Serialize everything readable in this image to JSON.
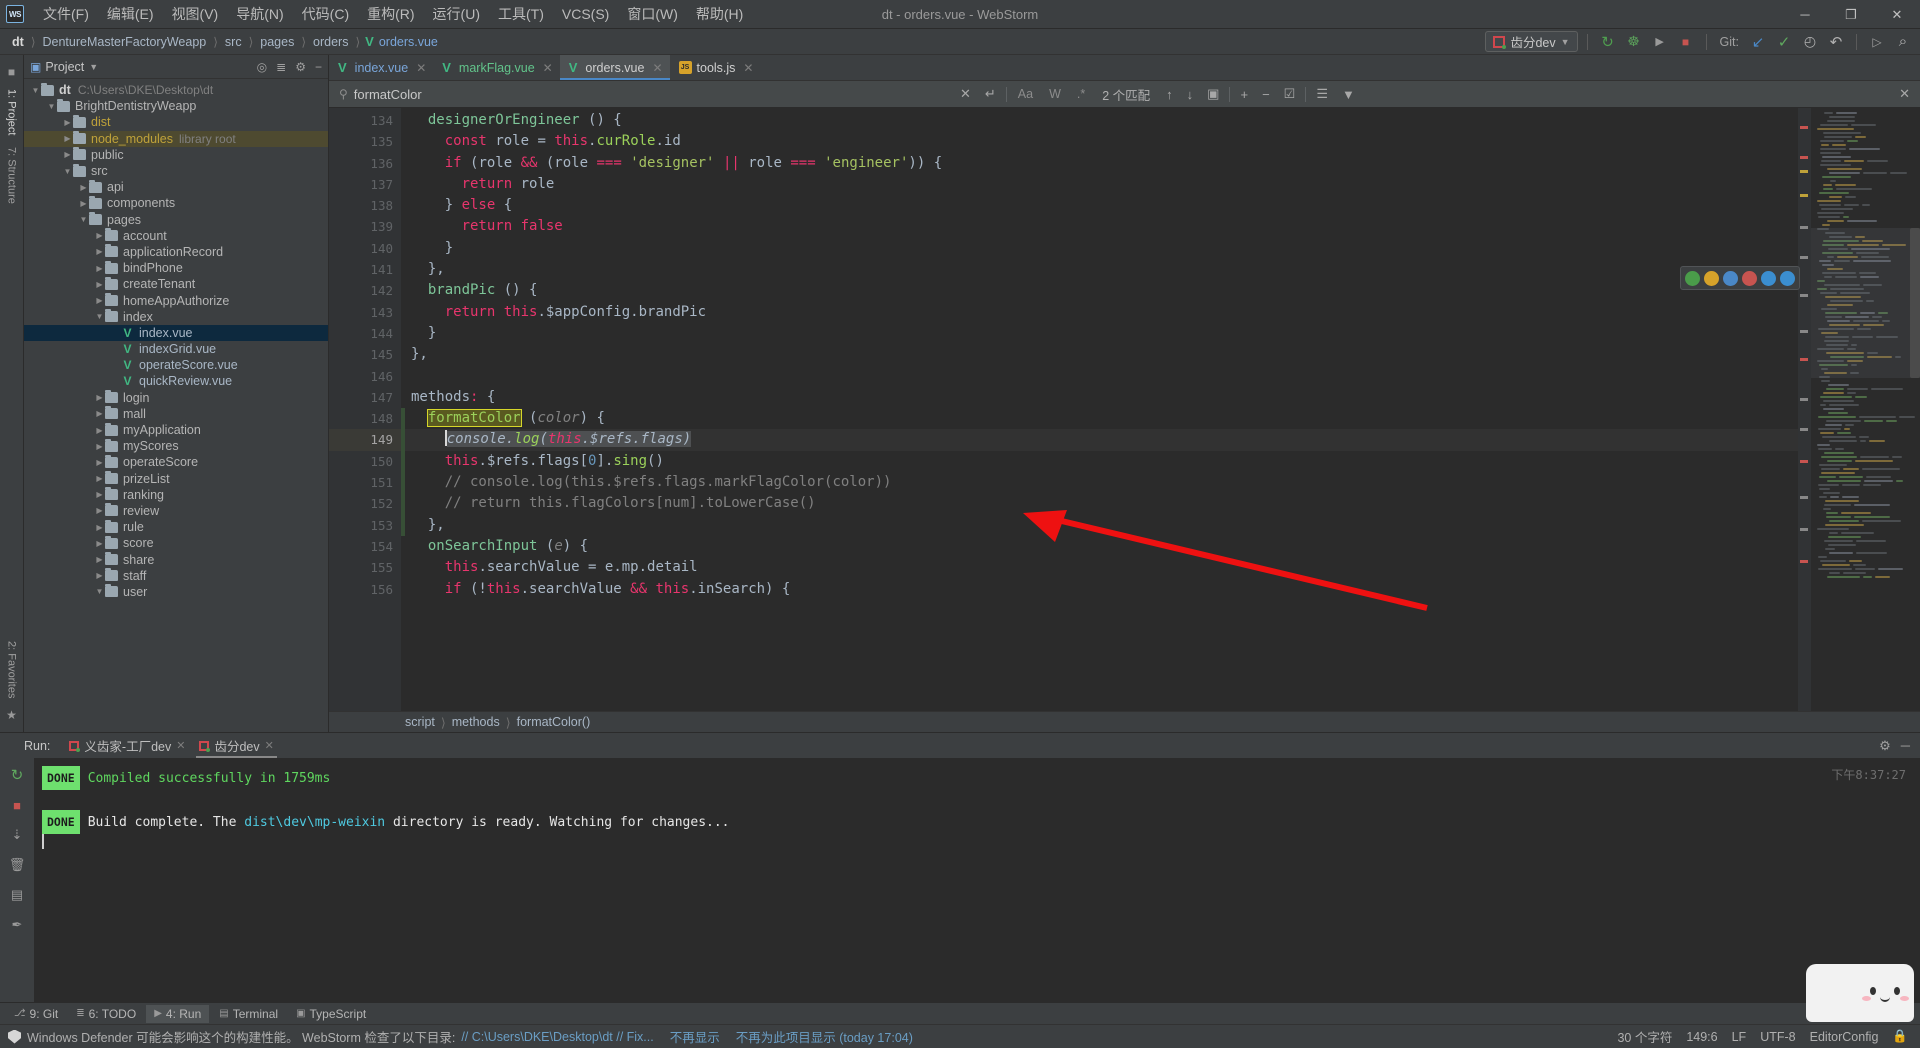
{
  "window": {
    "title": "dt - orders.vue - WebStorm",
    "logo": "WS",
    "controls": {
      "minimize": "─",
      "maximize": "❐",
      "close": "✕"
    }
  },
  "menu": {
    "items": [
      {
        "label": "文件(F)"
      },
      {
        "label": "编辑(E)"
      },
      {
        "label": "视图(V)"
      },
      {
        "label": "导航(N)"
      },
      {
        "label": "代码(C)"
      },
      {
        "label": "重构(R)"
      },
      {
        "label": "运行(U)"
      },
      {
        "label": "工具(T)"
      },
      {
        "label": "VCS(S)"
      },
      {
        "label": "窗口(W)"
      },
      {
        "label": "帮助(H)"
      }
    ]
  },
  "breadcrumb": {
    "items": [
      "dt",
      "DentureMasterFactoryWeapp",
      "src",
      "pages",
      "orders"
    ],
    "file": "orders.vue",
    "file_icon": "vue-icon"
  },
  "toolbar": {
    "run_config": "齿分dev",
    "run_config_icon": "run-config-icon",
    "buttons": [
      {
        "name": "rerun-icon",
        "glyph": "↻",
        "color": "#4f9e4f"
      },
      {
        "name": "debug-icon",
        "glyph": "☸",
        "color": "#5a9e5a"
      },
      {
        "name": "run-with-coverage-icon",
        "glyph": "▶",
        "color": "#9a9a9a"
      },
      {
        "name": "stop-icon",
        "glyph": "■",
        "color": "#c75450"
      }
    ],
    "git_label": "Git:",
    "git_buttons": [
      {
        "name": "update-project-icon",
        "glyph": "↙",
        "color": "#4a88c7"
      },
      {
        "name": "commit-icon",
        "glyph": "✓",
        "color": "#5fa85f"
      },
      {
        "name": "history-icon",
        "glyph": "◴",
        "color": "#b0b0b0"
      },
      {
        "name": "rollback-icon",
        "glyph": "↶",
        "color": "#b0b0b0"
      }
    ],
    "right_buttons": [
      {
        "name": "search-everywhere-icon",
        "glyph": "⌕"
      }
    ]
  },
  "left_strip": {
    "top_label": "1: Project",
    "structure_label": "7: Structure",
    "favorites_label": "2: Favorites"
  },
  "project": {
    "title": "Project",
    "header_icons": [
      "target-icon",
      "collapse-all-icon",
      "settings-icon",
      "hide-icon"
    ],
    "tree": [
      {
        "depth": 0,
        "arrow": "▼",
        "icon": "folder",
        "name": "dt",
        "bold": true,
        "suffix": "C:\\Users\\DKE\\Desktop\\dt"
      },
      {
        "depth": 1,
        "arrow": "▼",
        "icon": "folder",
        "name": "BrightDentistryWeapp"
      },
      {
        "depth": 2,
        "arrow": "▶",
        "icon": "folder",
        "name": "dist",
        "color": "yellow"
      },
      {
        "depth": 2,
        "arrow": "▶",
        "icon": "folder",
        "name": "node_modules",
        "color": "yellow",
        "suffix": "library root",
        "highlight": true
      },
      {
        "depth": 2,
        "arrow": "▶",
        "icon": "folder",
        "name": "public"
      },
      {
        "depth": 2,
        "arrow": "▼",
        "icon": "folder",
        "name": "src"
      },
      {
        "depth": 3,
        "arrow": "▶",
        "icon": "folder",
        "name": "api"
      },
      {
        "depth": 3,
        "arrow": "▶",
        "icon": "folder",
        "name": "components"
      },
      {
        "depth": 3,
        "arrow": "▼",
        "icon": "folder",
        "name": "pages"
      },
      {
        "depth": 4,
        "arrow": "▶",
        "icon": "folder",
        "name": "account"
      },
      {
        "depth": 4,
        "arrow": "▶",
        "icon": "folder",
        "name": "applicationRecord"
      },
      {
        "depth": 4,
        "arrow": "▶",
        "icon": "folder",
        "name": "bindPhone"
      },
      {
        "depth": 4,
        "arrow": "▶",
        "icon": "folder",
        "name": "createTenant"
      },
      {
        "depth": 4,
        "arrow": "▶",
        "icon": "folder",
        "name": "homeAppAuthorize"
      },
      {
        "depth": 4,
        "arrow": "▼",
        "icon": "folder",
        "name": "index"
      },
      {
        "depth": 5,
        "arrow": "",
        "icon": "vue",
        "name": "index.vue",
        "selected": true
      },
      {
        "depth": 5,
        "arrow": "",
        "icon": "vue",
        "name": "indexGrid.vue"
      },
      {
        "depth": 5,
        "arrow": "",
        "icon": "vue",
        "name": "operateScore.vue"
      },
      {
        "depth": 5,
        "arrow": "",
        "icon": "vue",
        "name": "quickReview.vue"
      },
      {
        "depth": 4,
        "arrow": "▶",
        "icon": "folder",
        "name": "login"
      },
      {
        "depth": 4,
        "arrow": "▶",
        "icon": "folder",
        "name": "mall"
      },
      {
        "depth": 4,
        "arrow": "▶",
        "icon": "folder",
        "name": "myApplication"
      },
      {
        "depth": 4,
        "arrow": "▶",
        "icon": "folder",
        "name": "myScores"
      },
      {
        "depth": 4,
        "arrow": "▶",
        "icon": "folder",
        "name": "operateScore"
      },
      {
        "depth": 4,
        "arrow": "▶",
        "icon": "folder",
        "name": "prizeList"
      },
      {
        "depth": 4,
        "arrow": "▶",
        "icon": "folder",
        "name": "ranking"
      },
      {
        "depth": 4,
        "arrow": "▶",
        "icon": "folder",
        "name": "review"
      },
      {
        "depth": 4,
        "arrow": "▶",
        "icon": "folder",
        "name": "rule"
      },
      {
        "depth": 4,
        "arrow": "▶",
        "icon": "folder",
        "name": "score"
      },
      {
        "depth": 4,
        "arrow": "▶",
        "icon": "folder",
        "name": "share"
      },
      {
        "depth": 4,
        "arrow": "▶",
        "icon": "folder",
        "name": "staff"
      },
      {
        "depth": 4,
        "arrow": "▼",
        "icon": "folder",
        "name": "user"
      }
    ]
  },
  "editor_tabs": [
    {
      "label": "index.vue",
      "icon": "vue-icon",
      "color": "blue",
      "active": false
    },
    {
      "label": "markFlag.vue",
      "icon": "vue-icon",
      "color": "green",
      "active": false
    },
    {
      "label": "orders.vue",
      "icon": "vue-icon",
      "color": "white",
      "active": true
    },
    {
      "label": "tools.js",
      "icon": "js-icon",
      "color": "white",
      "active": false
    }
  ],
  "search": {
    "value": "formatColor",
    "placeholder": "Search",
    "toggles": [
      {
        "name": "match-case-toggle",
        "label": "Aa"
      },
      {
        "name": "whole-words-toggle",
        "label": "W"
      },
      {
        "name": "regex-toggle",
        "label": ".*"
      }
    ],
    "match_count": "2 个匹配",
    "nav": [
      {
        "name": "prev-match-button",
        "glyph": "↑"
      },
      {
        "name": "next-match-button",
        "glyph": "↓"
      },
      {
        "name": "select-all-occurrences-button",
        "glyph": "▣"
      }
    ],
    "right_icons": [
      {
        "name": "add-selection-icon",
        "glyph": "+"
      },
      {
        "name": "remove-selection-icon",
        "glyph": "−"
      },
      {
        "name": "select-all-icon",
        "glyph": "☑"
      },
      {
        "name": "open-in-find-window-icon",
        "glyph": "☰"
      },
      {
        "name": "filter-icon",
        "glyph": "▼"
      }
    ],
    "close_glyph": "✕",
    "replace_glyph": "↵"
  },
  "code": {
    "first_line": 134,
    "current_line": 149,
    "lines": [
      {
        "n": 134,
        "fold": "-",
        "change": false,
        "html": "  <span class='f'>designerOrEngineer</span> <span class='p'>() {</span>"
      },
      {
        "n": 135,
        "fold": "",
        "change": false,
        "html": "    <span class='kw'>const</span> <span class='p'>role = </span><span class='this'>this</span><span class='p'>.</span><span class='fn'>curRole</span><span class='p'>.id</span>"
      },
      {
        "n": 136,
        "fold": "-",
        "change": false,
        "html": "    <span class='kw'>if</span> <span class='p'>(role </span><span class='kw'>&amp;&amp;</span><span class='p'> (role </span><span class='kw'>===</span><span class='p'> </span><span class='s'>'designer'</span><span class='p'> </span><span class='kw'>||</span><span class='p'> role </span><span class='kw'>===</span><span class='p'> </span><span class='s'>'engineer'</span><span class='p'>)) {</span>"
      },
      {
        "n": 137,
        "fold": "",
        "change": false,
        "html": "      <span class='kw'>return</span><span class='p'> role</span>"
      },
      {
        "n": 138,
        "fold": "-",
        "change": false,
        "html": "    <span class='p'>} </span><span class='kw'>else</span><span class='p'> {</span>"
      },
      {
        "n": 139,
        "fold": "",
        "change": false,
        "html": "      <span class='kw'>return</span><span class='p'> </span><span class='kw'>false</span>"
      },
      {
        "n": 140,
        "fold": "-",
        "change": false,
        "html": "    <span class='p'>}</span>"
      },
      {
        "n": 141,
        "fold": "",
        "change": false,
        "html": "  <span class='p'>},</span>"
      },
      {
        "n": 142,
        "fold": "-",
        "change": false,
        "html": "  <span class='f'>brandPic</span> <span class='p'>() {</span>"
      },
      {
        "n": 143,
        "fold": "",
        "change": false,
        "html": "    <span class='kw'>return</span><span class='p'> </span><span class='this'>this</span><span class='p'>.$appConfig.brandPic</span>"
      },
      {
        "n": 144,
        "fold": "-",
        "change": false,
        "html": "  <span class='p'>}</span>"
      },
      {
        "n": 145,
        "fold": "-",
        "change": false,
        "html": "<span class='p'>},</span>"
      },
      {
        "n": 146,
        "fold": "",
        "change": false,
        "html": ""
      },
      {
        "n": 147,
        "fold": "-",
        "change": false,
        "html": "<span class='p'>methods</span><span class='kw'>:</span><span class='p'> {</span>"
      },
      {
        "n": 148,
        "fold": "-",
        "change": true,
        "html": "  <span class='match-hl'>formatColor</span> <span class='p'>(</span><span class='c italic'>color</span><span class='p'>) {</span>"
      },
      {
        "n": 149,
        "fold": "",
        "change": true,
        "current": true,
        "html": "    <span class='caret'></span><span class='sel-hl italic'><span class='id'>console</span><span class='p'>.</span><span class='fn'>log</span><span class='p'>(</span><span class='this'>this</span><span class='p'>.$refs.flags)</span></span>"
      },
      {
        "n": 150,
        "fold": "",
        "change": true,
        "html": "    <span class='this'>this</span><span class='p'>.$refs.flags[</span><span class='n'>0</span><span class='p'>].</span><span class='fn'>sing</span><span class='p'>()</span>"
      },
      {
        "n": 151,
        "fold": "-",
        "change": true,
        "html": "    <span class='c'>// console.log(this.$refs.flags.markFlagColor(color))</span>"
      },
      {
        "n": 152,
        "fold": "-",
        "change": true,
        "html": "    <span class='c'>// return this.flagColors[num].toLowerCase()</span>"
      },
      {
        "n": 153,
        "fold": "-",
        "change": true,
        "html": "  <span class='p'>},</span>"
      },
      {
        "n": 154,
        "fold": "-",
        "change": false,
        "html": "  <span class='f'>onSearchInput</span> <span class='p'>(</span><span class='c italic'>e</span><span class='p'>) {</span>"
      },
      {
        "n": 155,
        "fold": "",
        "change": false,
        "html": "    <span class='this'>this</span><span class='p'>.searchValue = </span><span class='id'>e</span><span class='p'>.mp.detail</span>"
      },
      {
        "n": 156,
        "fold": "-",
        "change": false,
        "html": "    <span class='kw'>if</span><span class='p'> (!</span><span class='this'>this</span><span class='p'>.searchValue </span><span class='kw'>&amp;&amp;</span><span class='p'> </span><span class='this'>this</span><span class='p'>.inSearch) {</span>"
      }
    ]
  },
  "editor_breadcrumbs": [
    "script",
    "methods",
    "formatColor()"
  ],
  "inspection_widget": {
    "dots": [
      {
        "name": "inspection-ok-icon",
        "color": "#4a9c4a"
      },
      {
        "name": "inspection-warn-icon",
        "color": "#d6a22a"
      },
      {
        "name": "inspection-info-icon",
        "color": "#4a88c7"
      },
      {
        "name": "inspection-error-icon",
        "color": "#c75450"
      },
      {
        "name": "inspection-typo-icon",
        "color": "#3b8ed0"
      },
      {
        "name": "inspection-settings-icon",
        "color": "#3b8ed0"
      }
    ]
  },
  "run_panel": {
    "label": "Run:",
    "tabs": [
      {
        "label": "义齿家-工厂dev",
        "active": false
      },
      {
        "label": "齿分dev",
        "active": true
      }
    ],
    "header_icons": [
      {
        "name": "settings-icon",
        "glyph": "⚙"
      },
      {
        "name": "hide-icon",
        "glyph": "─"
      }
    ],
    "side_icons": [
      {
        "name": "rerun-icon",
        "glyph": "↻",
        "color": "#5fa85f"
      },
      {
        "name": "stop-icon",
        "glyph": "■",
        "color": "#c75450"
      },
      {
        "name": "scroll-to-end-icon",
        "glyph": "↓",
        "color": "#9a9a9a"
      },
      {
        "name": "trash-icon",
        "glyph": "Ὕ1",
        "color": "#9a9a9a"
      },
      {
        "name": "print-icon",
        "glyph": "☷",
        "color": "#9a9a9a"
      },
      {
        "name": "pin-icon",
        "glyph": "✐",
        "color": "#9a9a9a"
      }
    ],
    "console": [
      {
        "badge": "DONE",
        "segments": [
          {
            "text": "Compiled successfully in 1759ms",
            "color": "green"
          }
        ]
      },
      {
        "badge": "",
        "segments": []
      },
      {
        "badge": "DONE",
        "segments": [
          {
            "text": "Build complete. The ",
            "color": "white"
          },
          {
            "text": "dist\\dev\\mp-weixin",
            "color": "cyan"
          },
          {
            "text": " directory is ready. Watching for changes...",
            "color": "white"
          }
        ]
      }
    ],
    "timestamp": "下午8:37:27"
  },
  "bottom_toolwindows": [
    {
      "label": "9: Git",
      "icon": "git-icon",
      "active": false
    },
    {
      "label": "6: TODO",
      "icon": "todo-icon",
      "active": false
    },
    {
      "label": "4: Run",
      "icon": "run-icon",
      "active": true
    },
    {
      "label": "Terminal",
      "icon": "terminal-icon",
      "active": false
    },
    {
      "label": "TypeScript",
      "icon": "typescript-icon",
      "active": false
    }
  ],
  "status_bar": {
    "message_prefix": "Windows Defender 可能会影响这个的构建性能。 WebStorm 检查了以下目录: ",
    "link_fix": "// C:\\Users\\DKE\\Desktop\\dt // Fix...",
    "dismiss": "不再显示",
    "dismiss_project": "不再为此项目显示 (today 17:04)",
    "char_count": "30 个字符",
    "position": "149:6",
    "line_sep": "LF",
    "encoding": "UTF-8",
    "editorconfig": "EditorConfig"
  }
}
